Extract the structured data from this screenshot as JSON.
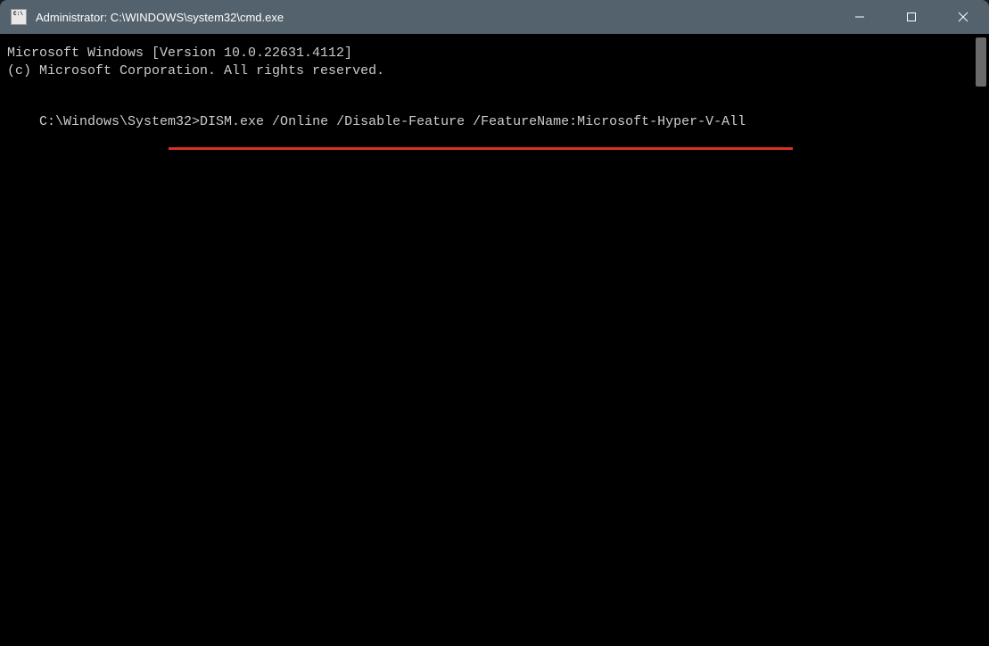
{
  "window": {
    "title": "Administrator: C:\\WINDOWS\\system32\\cmd.exe"
  },
  "terminal": {
    "line1": "Microsoft Windows [Version 10.0.22631.4112]",
    "line2": "(c) Microsoft Corporation. All rights reserved.",
    "prompt": "C:\\Windows\\System32>",
    "command": "DISM.exe /Online /Disable-Feature /FeatureName:Microsoft-Hyper-V-All"
  }
}
